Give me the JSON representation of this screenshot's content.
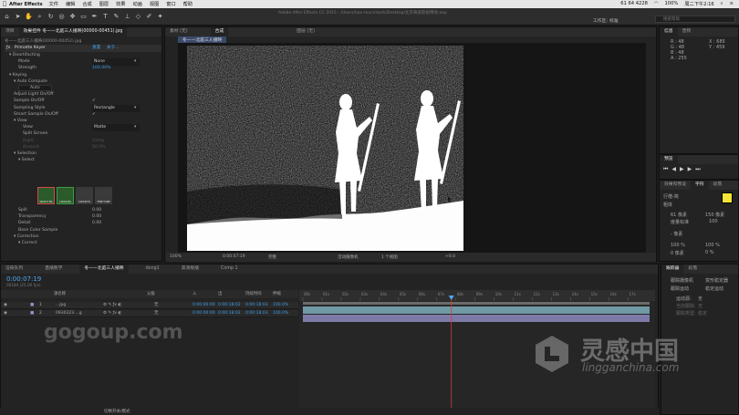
{
  "menubar": {
    "app": "After Effects",
    "items": [
      "文件",
      "编辑",
      "合成",
      "图层",
      "效果",
      "动画",
      "视图",
      "窗口",
      "帮助"
    ],
    "status": [
      "61 64 4228",
      "100%",
      "周二下午2:16"
    ]
  },
  "window": {
    "title": "Adobe After Effects CC 2015 - /Users/hao-macintosh/Desktop/北京奇迹影视特效.aep",
    "workspace_label": "工作区:",
    "workspace_name": "标准",
    "search_placeholder": "搜索帮助"
  },
  "effect_controls": {
    "tabs": [
      "项目",
      "效果控件 冬——北庭三人播映(00000-00451).jpg"
    ],
    "breadcrumb": "冬——北庭三人播映(00000-00452).jpg",
    "reset": "重置",
    "about": "关于...",
    "effect_name": "Primatte Keyer",
    "rows": [
      {
        "label": "Deartifacting",
        "indent": 1,
        "twirl": "▾"
      },
      {
        "label": "Mode",
        "indent": 3,
        "value": "None",
        "dropdown": true
      },
      {
        "label": "Strength",
        "indent": 3,
        "value": "100.00%",
        "blue": true
      },
      {
        "label": "Keying",
        "indent": 1,
        "twirl": "▾"
      },
      {
        "label": "Auto Compute",
        "indent": 2,
        "twirl": "▾"
      },
      {
        "label": "Auto",
        "indent": 3,
        "button": true
      },
      {
        "label": "Adjust Light On/Off",
        "indent": 2
      },
      {
        "label": "Sample On/Off",
        "indent": 2,
        "value": "✓",
        "check": true
      },
      {
        "label": "Sampling Style",
        "indent": 2,
        "value": "Rectangle",
        "dropdown": true
      },
      {
        "label": "Smart Sample On/Off",
        "indent": 2,
        "value": "✓",
        "check": true
      },
      {
        "label": "View",
        "indent": 2,
        "twirl": "▾"
      },
      {
        "label": "View",
        "indent": 4,
        "value": "Matte",
        "dropdown": true
      },
      {
        "label": "Split Screen",
        "indent": 4
      },
      {
        "label": "Right",
        "indent": 4,
        "value": "Comp",
        "dim": true
      },
      {
        "label": "Amount",
        "indent": 4,
        "value": "50.0%",
        "dim": true
      },
      {
        "label": "Selection",
        "indent": 2,
        "twirl": "▾"
      },
      {
        "label": "Select",
        "indent": 3,
        "twirl": "▾"
      }
    ],
    "select_buttons": [
      "SELECT BG",
      "CLEAN BG",
      "CLEAN FG",
      "FINE TUNE"
    ],
    "rows2": [
      {
        "label": "Spill",
        "indent": 3,
        "value": "0.00"
      },
      {
        "label": "Transparency",
        "indent": 3,
        "value": "0.00"
      },
      {
        "label": "Detail",
        "indent": 3,
        "value": "0.00"
      },
      {
        "label": "Base Color Sample",
        "indent": 3
      },
      {
        "label": "Correction",
        "indent": 2,
        "twirl": "▾"
      },
      {
        "label": "Correct",
        "indent": 3,
        "twirl": "▾"
      }
    ]
  },
  "composition": {
    "tabs": [
      "素材 (无)",
      "合成",
      "图层 (无)"
    ],
    "comp_tab": "冬——北庭三人播映",
    "zoom": "100%",
    "timecode": "0:00:07:19",
    "resolution": "完整",
    "camera": "活动摄像机",
    "views": "1 个视图",
    "exposure": "+0.0"
  },
  "info": {
    "title": "信息",
    "audio_tab": "音频",
    "lines": [
      "R : 48",
      "G : 48",
      "B : 48",
      "A : 255"
    ],
    "coords": [
      "X : 685",
      "Y : 459"
    ]
  },
  "preview": {
    "title": "预览"
  },
  "effects_presets": {
    "tabs": [
      "效果和预设",
      "字符",
      "段落"
    ],
    "font": "行楷-简",
    "style": "粗体",
    "size": "61 像素",
    "leading": "150 像素",
    "kerning": "度量标准",
    "tracking": "100",
    "stroke": "- 像素",
    "v_scale": "100 %",
    "h_scale": "100 %",
    "baseline": "0 像素",
    "tsume": "0 %",
    "swatch_color": "#f5e536"
  },
  "timeline": {
    "tabs": [
      "渲染队列",
      "直播教学",
      "冬——北庭三人播映",
      "dong1",
      "高清版播",
      "Comp 1"
    ],
    "timecode": "0:00:07:19",
    "frame_info": "00184 (25.00 fps)",
    "col_source": "源名称",
    "col_parent": "父级",
    "col_in": "入",
    "col_out": "出",
    "col_duration": "持续时间",
    "col_stretch": "伸缩",
    "layers": [
      {
        "num": "1",
        "name": "...jpg",
        "parent": "无",
        "in": "0:00:00:00",
        "out": "0:00:18:02",
        "duration": "0:00:18:03",
        "stretch": "100.0%",
        "color": "#a28fd1"
      },
      {
        "num": "2",
        "name": "0930323....g",
        "parent": "无",
        "in": "0:00:00:00",
        "out": "0:00:18:02",
        "duration": "0:00:18:03",
        "stretch": "100.0%",
        "color": "#a28fd1"
      }
    ],
    "ruler": [
      "00s",
      "01s",
      "02s",
      "03s",
      "04s",
      "05s",
      "06s",
      "07s",
      "08s",
      "09s",
      "10s",
      "11s",
      "12s",
      "13s",
      "14s",
      "15s",
      "16s",
      "17s"
    ],
    "playhead_seconds": 7.76,
    "duration_seconds": 18.12,
    "status_text": "切换开关/模式"
  },
  "tracker": {
    "tabs": [
      "跟踪器",
      "段落"
    ],
    "buttons": [
      "跟踪摄像机",
      "变形稳定器",
      "跟踪运动",
      "稳定运动"
    ],
    "motion_source_label": "运动源:",
    "motion_source": "无",
    "current_track_label": "当前跟踪:",
    "current_track": "无",
    "track_type_label": "跟踪类型:",
    "track_type": "稳定"
  },
  "watermarks": {
    "left": "gogoup.com",
    "right_cn": "灵感中国",
    "right_url": "lingganchina.com"
  }
}
